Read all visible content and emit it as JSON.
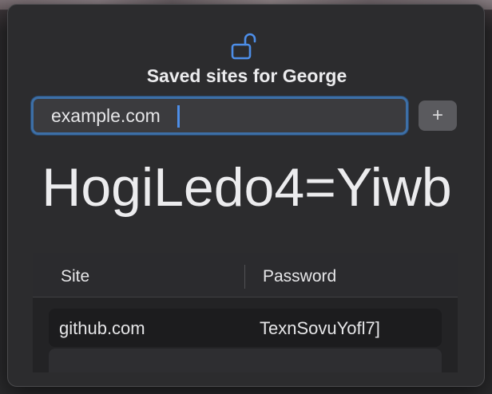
{
  "window": {
    "title": "Saved sites for George"
  },
  "site_input": {
    "value": "example.com",
    "placeholder": ""
  },
  "add_button": {
    "label": "+"
  },
  "generated_password": "HogiLedo4=Yiwb",
  "table": {
    "columns": [
      "Site",
      "Password"
    ],
    "rows": [
      {
        "site": "github.com",
        "password": "TexnSovuYofl7]"
      }
    ]
  },
  "icons": {
    "lock": "unlocked-lock-icon"
  },
  "colors": {
    "accent": "#3d6fa6",
    "panel_bg": "#2c2c2e",
    "text": "#ececee"
  }
}
